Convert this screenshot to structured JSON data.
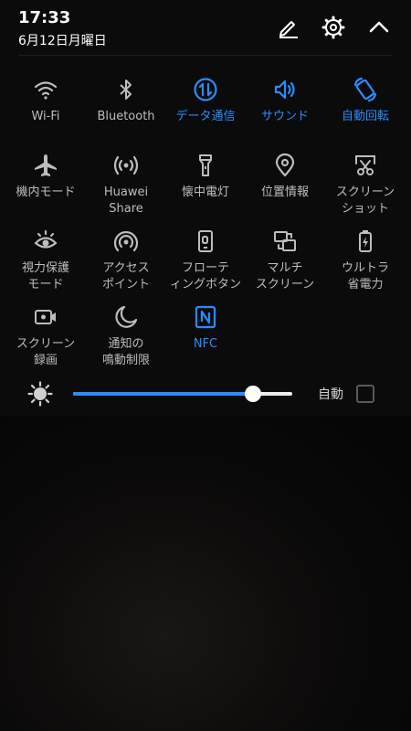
{
  "status": {
    "time": "17:33",
    "date": "6月12日月曜日"
  },
  "header_icons": [
    "edit-icon",
    "settings-gear-icon",
    "collapse-chevron-up-icon"
  ],
  "tiles": [
    {
      "label": "Wi-Fi",
      "active": false,
      "icon": "wifi-icon"
    },
    {
      "label": "Bluetooth",
      "active": false,
      "icon": "bluetooth-icon"
    },
    {
      "label": "データ通信",
      "active": true,
      "icon": "mobile-data-icon"
    },
    {
      "label": "サウンド",
      "active": true,
      "icon": "sound-icon"
    },
    {
      "label": "自動回転",
      "active": true,
      "icon": "auto-rotate-icon"
    },
    {
      "label": "機内モード",
      "active": false,
      "icon": "airplane-icon"
    },
    {
      "label": "Huawei Share",
      "active": false,
      "icon": "huawei-share-icon"
    },
    {
      "label": "懐中電灯",
      "active": false,
      "icon": "flashlight-icon"
    },
    {
      "label": "位置情報",
      "active": false,
      "icon": "location-icon"
    },
    {
      "label": "スクリーン\nショット",
      "active": false,
      "icon": "screenshot-icon"
    },
    {
      "label": "視力保護\nモード",
      "active": false,
      "icon": "eye-comfort-icon"
    },
    {
      "label": "アクセス\nポイント",
      "active": false,
      "icon": "hotspot-icon"
    },
    {
      "label": "フローテ\nィングボタン",
      "active": false,
      "icon": "floating-dock-icon"
    },
    {
      "label": "マルチ\nスクリーン",
      "active": false,
      "icon": "multi-screen-icon"
    },
    {
      "label": "ウルトラ\n省電力",
      "active": false,
      "icon": "ultra-power-saving-icon"
    },
    {
      "label": "スクリーン\n録画",
      "active": false,
      "icon": "screen-record-icon"
    },
    {
      "label": "通知の\n鳴動制限",
      "active": false,
      "icon": "do-not-disturb-icon"
    },
    {
      "label": "NFC",
      "active": true,
      "icon": "nfc-icon"
    }
  ],
  "brightness": {
    "level": 0.82,
    "auto_label": "自動",
    "auto_checked": false,
    "icon": "brightness-sun-icon"
  },
  "colors": {
    "active": "#2a8cff",
    "inactive": "#bdbdbd",
    "panel": "#0b0b0b"
  }
}
